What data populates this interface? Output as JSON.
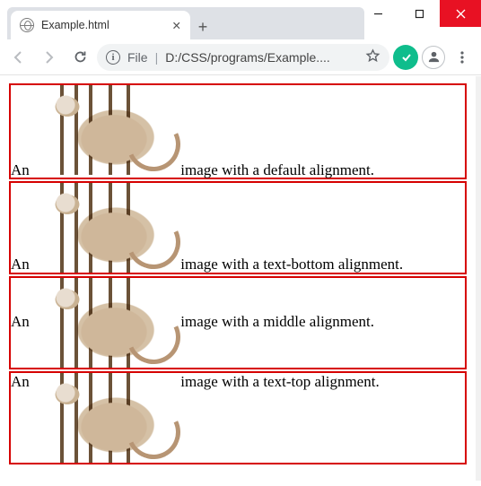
{
  "window": {
    "tab_title": "Example.html",
    "minimize_tip": "Minimize",
    "maximize_tip": "Maximize",
    "close_tip": "Close"
  },
  "toolbar": {
    "back_tip": "Back",
    "forward_tip": "Forward",
    "reload_tip": "Reload",
    "info_label": "File",
    "url_display": "D:/CSS/programs/Example....",
    "star_tip": "Bookmark",
    "menu_tip": "Menu"
  },
  "rows": {
    "prefix": "An",
    "r1": "image with a default alignment.",
    "r2": "image with a text-bottom alignment.",
    "r3": "image with a middle alignment.",
    "r4": "image with a text-top alignment."
  }
}
